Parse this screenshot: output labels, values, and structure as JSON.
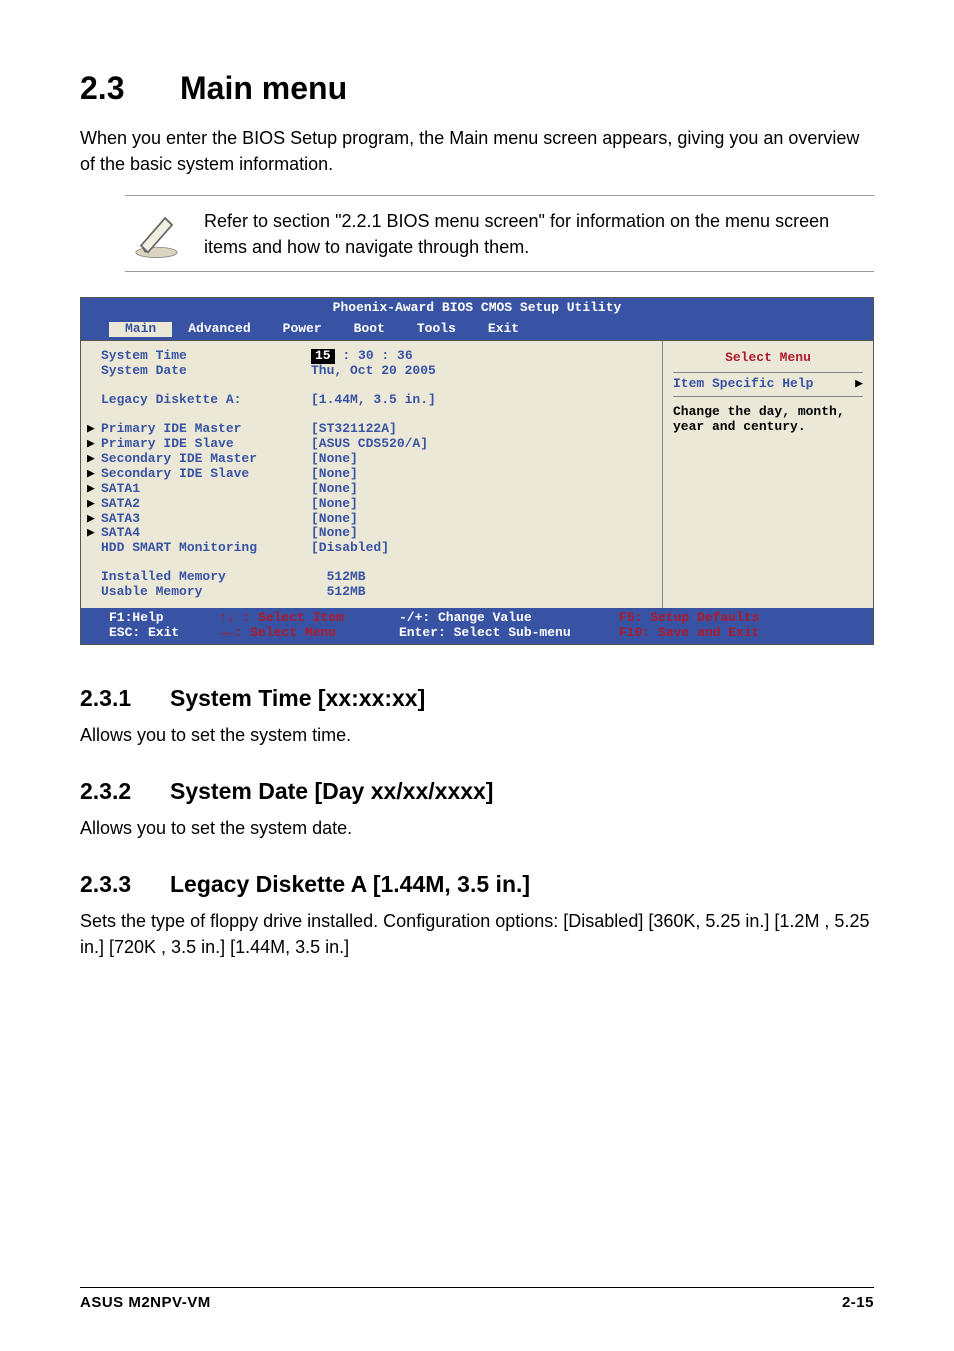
{
  "heading": {
    "num": "2.3",
    "title": "Main menu"
  },
  "intro": "When you enter the BIOS Setup program, the Main menu screen appears, giving you an overview of the basic system information.",
  "note": "Refer to section \"2.2.1  BIOS menu screen\" for information on the menu screen items and how to navigate through them.",
  "bios": {
    "title": "Phoenix-Award BIOS CMOS Setup Utility",
    "menus": [
      "Main",
      "Advanced",
      "Power",
      "Boot",
      "Tools",
      "Exit"
    ],
    "selected_menu": "Main",
    "items": [
      {
        "label": "System Time",
        "value_prefix": "",
        "value": " : 30 : 36",
        "highlight": "15",
        "arrow": false
      },
      {
        "label": "System Date",
        "value": "Thu, Oct 20 2005",
        "arrow": false
      },
      {
        "spacer": true
      },
      {
        "label": "Legacy Diskette A:",
        "value": "[1.44M, 3.5 in.]",
        "arrow": false,
        "indent": true
      },
      {
        "spacer": true
      },
      {
        "label": "Primary IDE Master",
        "value": "[ST321122A]",
        "arrow": true
      },
      {
        "label": "Primary IDE Slave",
        "value": "[ASUS CDS520/A]",
        "arrow": true
      },
      {
        "label": "Secondary IDE Master",
        "value": "[None]",
        "arrow": true
      },
      {
        "label": "Secondary IDE Slave",
        "value": "[None]",
        "arrow": true
      },
      {
        "label": "SATA1",
        "value": "[None]",
        "arrow": true
      },
      {
        "label": "SATA2",
        "value": "[None]",
        "arrow": true
      },
      {
        "label": "SATA3",
        "value": "[None]",
        "arrow": true
      },
      {
        "label": "SATA4",
        "value": "[None]",
        "arrow": true
      },
      {
        "label": "HDD SMART Monitoring",
        "value": "[Disabled]",
        "arrow": false,
        "indent": true
      },
      {
        "spacer": true
      },
      {
        "label": "Installed Memory",
        "value": "  512MB",
        "arrow": false,
        "indent": true
      },
      {
        "label": "Usable Memory",
        "value": "  512MB",
        "arrow": false,
        "indent": true
      }
    ],
    "right": {
      "select_menu": "Select Menu",
      "help_heading": "Item Specific Help",
      "help_text": "Change the day, month, year and century."
    },
    "footer": {
      "r1c1": "F1:Help",
      "r1c2": "↑↓ : Select Item",
      "r1c3": "-/+: Change Value",
      "r1c4": "F5: Setup Defaults",
      "r2c1": "ESC: Exit",
      "r2c2": "→←: Select Menu",
      "r2c3": "Enter: Select Sub-menu",
      "r2c4": "F10: Save and Exit"
    }
  },
  "subs": {
    "s1": {
      "num": "2.3.1",
      "title": "System Time [xx:xx:xx]",
      "text": "Allows you to set the system time."
    },
    "s2": {
      "num": "2.3.2",
      "title": "System Date [Day xx/xx/xxxx]",
      "text": "Allows you to set the system date."
    },
    "s3": {
      "num": "2.3.3",
      "title": "Legacy Diskette A [1.44M, 3.5 in.]",
      "text": "Sets the type of floppy drive installed. Configuration options: [Disabled] [360K, 5.25 in.] [1.2M , 5.25 in.] [720K , 3.5 in.] [1.44M, 3.5 in.]"
    }
  },
  "footer": {
    "left": "ASUS M2NPV-VM",
    "right": "2-15"
  }
}
